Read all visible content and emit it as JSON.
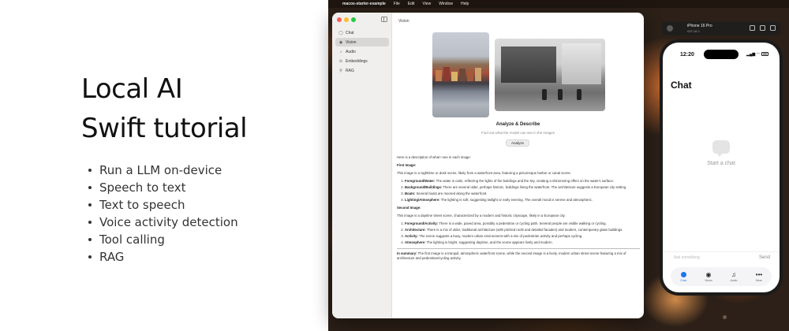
{
  "promo": {
    "title_line1": "Local AI",
    "title_line2": "Swift tutorial",
    "features": [
      "Run a LLM on-device",
      "Speech to text",
      "Text to speech",
      "Voice activity detection",
      "Tool calling",
      "RAG"
    ]
  },
  "menubar": {
    "apple": "",
    "app_name": "macos-starter-example",
    "items": [
      "File",
      "Edit",
      "View",
      "Window",
      "Help"
    ]
  },
  "mac_app": {
    "sidebar": [
      {
        "label": "Chat",
        "icon": "chat-bubble-icon",
        "glyph": "◯",
        "active": false
      },
      {
        "label": "Vision",
        "icon": "eye-icon",
        "glyph": "◉",
        "active": true
      },
      {
        "label": "Audio",
        "icon": "mic-icon",
        "glyph": "♪",
        "active": false
      },
      {
        "label": "Embeddings",
        "icon": "embeddings-icon",
        "glyph": "⊙",
        "active": false
      },
      {
        "label": "RAG",
        "icon": "search-icon",
        "glyph": "⚲",
        "active": false
      }
    ],
    "view_title": "Vision",
    "analyze_title": "Analyze & Describe",
    "analyze_subtitle": "Find out what the model can see in the images",
    "analyze_button": "Analyze",
    "result": {
      "intro": "Here is a description of what I see in each image:",
      "first_heading": "First Image:",
      "first_para": "This image is a nighttime or dusk scene, likely from a waterfront area, featuring a picturesque harbor or canal scene.",
      "first_items": [
        {
          "label": "Foreground/Water:",
          "text": " The water is calm, reflecting the lights of the buildings and the sky, creating a shimmering effect on the water's surface."
        },
        {
          "label": "Background/Buildings:",
          "text": " There are several older, perhaps historic, buildings lining the waterfront. The architecture suggests a European city setting."
        },
        {
          "label": "Boats:",
          "text": " Several boats are moored along the waterfront."
        },
        {
          "label": "Lighting/Atmosphere:",
          "text": " The lighting is soft, suggesting twilight or early evening. The overall mood is serene and atmospheric."
        }
      ],
      "second_heading": "Second Image:",
      "second_para": "This image is a daytime street scene, characterized by a modern and historic cityscape, likely in a European city.",
      "second_items": [
        {
          "label": "Foreground/Activity:",
          "text": " There is a wide, paved area, possibly a pedestrian or cycling path. Several people are visible walking or cycling."
        },
        {
          "label": "Architecture:",
          "text": " There is a mix of older, traditional architecture (with pitched roofs and detailed facades) and modern, contemporary glass buildings."
        },
        {
          "label": "Activity:",
          "text": " The scene suggests a busy, modern urban environment with a mix of pedestrian activity and perhaps cycling."
        },
        {
          "label": "Atmosphere:",
          "text": " The lighting is bright, suggesting daytime, and the scene appears lively and modern."
        }
      ],
      "summary_label": "In summary:",
      "summary_text": " The first image is a tranquil, atmospheric waterfront scene, while the second image is a lively, modern urban street scene featuring a mix of architecture and pedestrian/cycling activity."
    }
  },
  "simulator": {
    "device_name": "iPhone 16 Pro",
    "os": "iOS 18.2"
  },
  "phone": {
    "time": "12:20",
    "status": "▂▄▆ ◠",
    "title": "Chat",
    "empty_text": "Start a chat",
    "input_placeholder": "Ask something",
    "send_label": "Send",
    "tabs": [
      {
        "label": "Chat",
        "icon": "chat-icon",
        "glyph": "●",
        "active": true
      },
      {
        "label": "Vision",
        "icon": "eye-icon",
        "glyph": "◉",
        "active": false
      },
      {
        "label": "Audio",
        "icon": "waveform-icon",
        "glyph": "♫",
        "active": false
      },
      {
        "label": "More",
        "icon": "ellipsis-icon",
        "glyph": "•••",
        "active": false
      }
    ]
  },
  "colors": {
    "accent": "#1e74f0",
    "traffic_red": "#ff5f57",
    "traffic_yellow": "#febc2e",
    "traffic_green": "#28c840"
  }
}
